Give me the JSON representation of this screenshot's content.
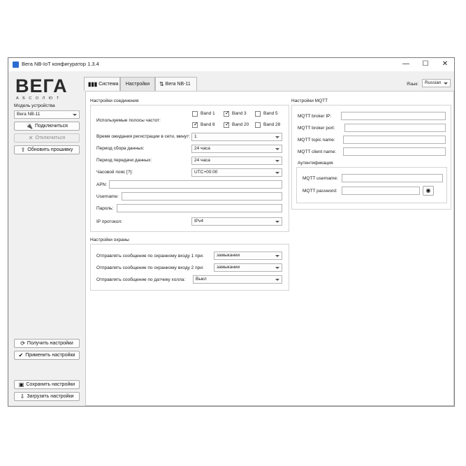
{
  "window": {
    "title": "Вега NB-IoT конфигуратор 1.3.4",
    "minimize_glyph": "—",
    "maximize_glyph": "☐",
    "close_glyph": "✕"
  },
  "brand": {
    "logo": "ВЕГА",
    "tagline": "А Б С О Л Ю Т"
  },
  "sidebar": {
    "model_label": "Модель устройства",
    "model_value": "Вега NB-11",
    "connect": "Подключиться",
    "disconnect": "Отключиться",
    "update_firmware": "Обновить прошивку",
    "get_settings": "Получить настройки",
    "apply_settings": "Применить настройки",
    "save_settings": "Сохранить настройки",
    "load_settings": "Загрузить настройки"
  },
  "tabs": [
    {
      "label": "Система"
    },
    {
      "label": "Настройки"
    },
    {
      "label": "Вега NB-11"
    }
  ],
  "language": {
    "label": "Язык:",
    "value": "Russian"
  },
  "connection": {
    "title": "Настройки соединения",
    "bands_label": "Используемые полосы частот:",
    "bands": [
      {
        "label": "Band 1",
        "checked": false
      },
      {
        "label": "Band 3",
        "checked": true
      },
      {
        "label": "Band 5",
        "checked": false
      },
      {
        "label": "Band 8",
        "checked": true
      },
      {
        "label": "Band 20",
        "checked": true
      },
      {
        "label": "Band 28",
        "checked": false
      }
    ],
    "reg_wait_label": "Время ожидания регистрации в сети, минут:",
    "reg_wait_value": "1",
    "collect_period_label": "Период сбора данных:",
    "collect_period_value": "24 часа",
    "send_period_label": "Период передачи данных:",
    "send_period_value": "24 часа",
    "timezone_label": "Часовой пояс [?]:",
    "timezone_value": "UTC+00:00",
    "apn_label": "APN:",
    "apn_value": "",
    "username_label": "Username:",
    "username_value": "",
    "password_label": "Пароль:",
    "password_value": "",
    "ip_protocol_label": "IP протокол:",
    "ip_protocol_value": "IPv4"
  },
  "security": {
    "title": "Настройки охраны",
    "input1_label": "Отправлять сообщение по охранному входу 1 при:",
    "input1_value": "замыкании",
    "input2_label": "Отправлять сообщение по охранному входу 2 при:",
    "input2_value": "замыкании",
    "hall_label": "Отправлять сообщение по датчику холла:",
    "hall_value": "Выкл"
  },
  "mqtt": {
    "title": "Настройки MQTT",
    "broker_ip_label": "MQTT broker IP:",
    "broker_port_label": "MQTT broker port:",
    "topic_label": "MQTT topic name:",
    "client_label": "MQTT client name:",
    "auth_title": "Аутентификация",
    "username_label": "MQTT username:",
    "password_label": "MQTT password:"
  },
  "icons": {
    "connect": "plug-icon",
    "disconnect": "x-icon",
    "update": "upload-icon",
    "get": "refresh-icon",
    "apply": "check-icon",
    "save": "floppy-icon",
    "load": "download-icon",
    "eye": "eye-icon"
  }
}
